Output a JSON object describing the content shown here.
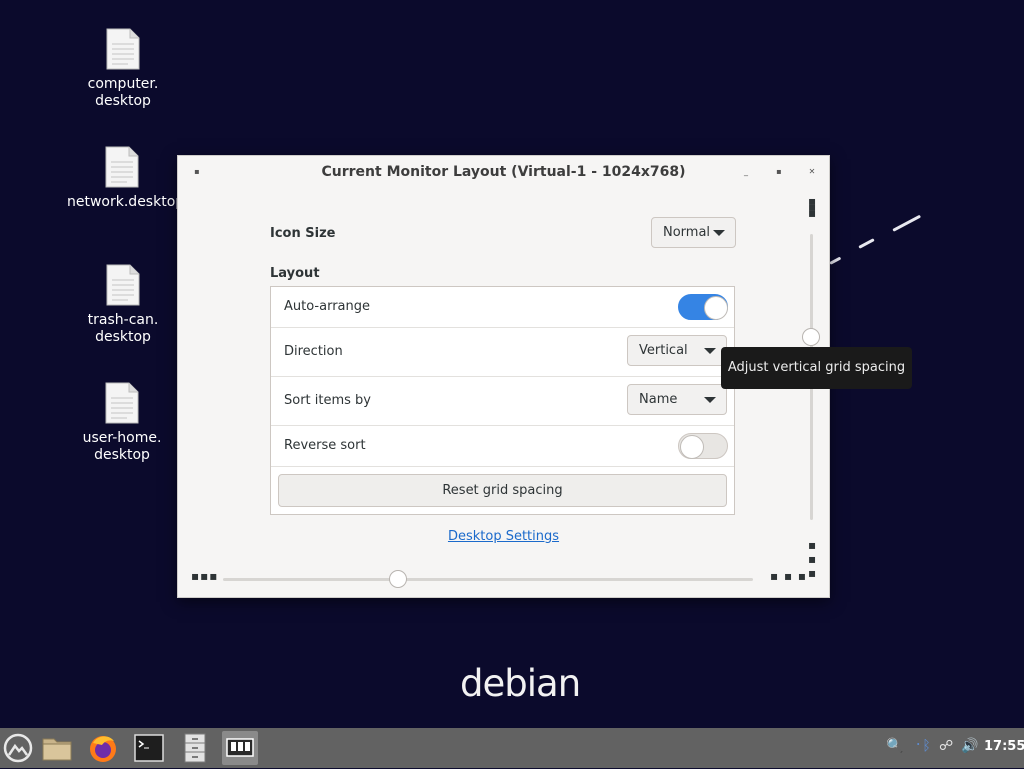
{
  "desktop": {
    "icons": [
      {
        "label": "computer.\ndesktop"
      },
      {
        "label": "network.desktop"
      },
      {
        "label": "trash-can.\ndesktop"
      },
      {
        "label": "user-home.\ndesktop"
      }
    ],
    "logo_text": "debian"
  },
  "window": {
    "title": "Current Monitor Layout (Virtual-1 - 1024x768)",
    "icon_size_label": "Icon Size",
    "icon_size_value": "Normal",
    "layout_label": "Layout",
    "auto_arrange_label": "Auto-arrange",
    "auto_arrange_on": true,
    "direction_label": "Direction",
    "direction_value": "Vertical",
    "sort_label": "Sort items by",
    "sort_value": "Name",
    "reverse_label": "Reverse sort",
    "reverse_on": false,
    "reset_button": "Reset grid spacing",
    "settings_link": "Desktop Settings",
    "tooltip": "Adjust vertical grid spacing",
    "horizontal_spacing_level": 0.33,
    "vertical_spacing_level": 0.36
  },
  "taskbar": {
    "clock": "17:55",
    "items": [
      "menu-icon",
      "file-manager-icon",
      "firefox-icon",
      "terminal-icon",
      "cabinet-icon",
      "display-settings-icon"
    ]
  },
  "colors": {
    "desktop_bg": "#0b0a2c",
    "accent": "#3584e4",
    "taskbar": "#626262"
  }
}
